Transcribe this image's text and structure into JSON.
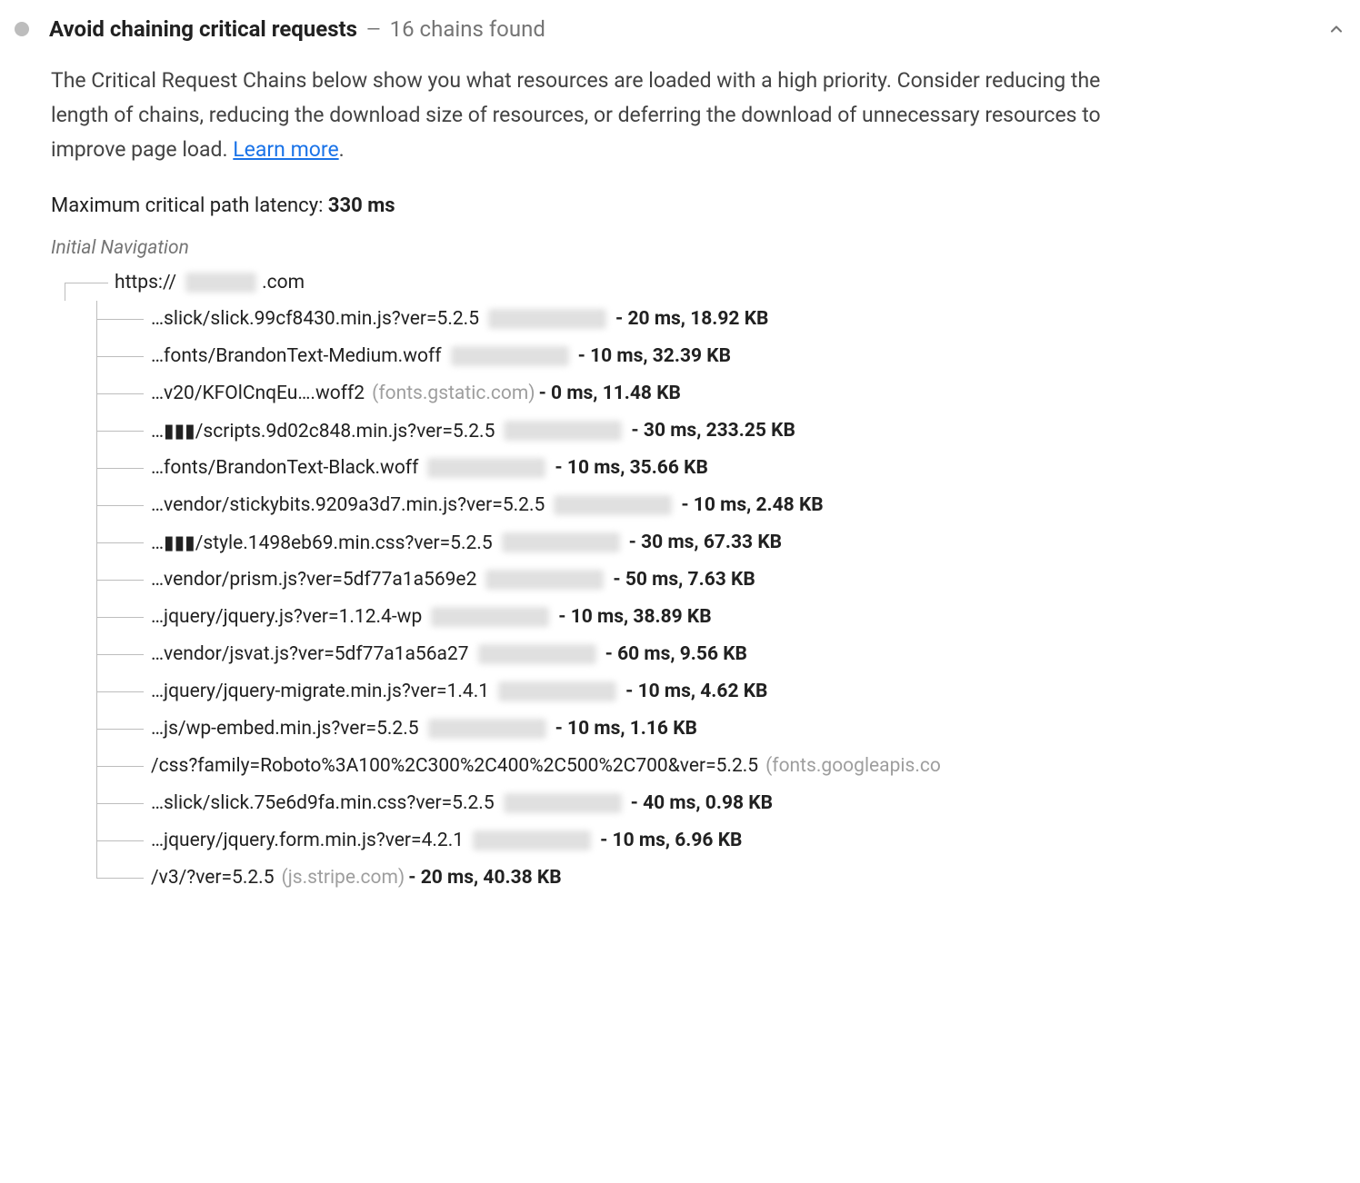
{
  "audit": {
    "title": "Avoid chaining critical requests",
    "count_text": "16 chains found",
    "description_pre": "The Critical Request Chains below show you what resources are loaded with a high priority. Consider reducing the length of chains, reducing the download size of resources, or deferring the download of unnecessary resources to improve page load. ",
    "learn_more": "Learn more",
    "latency_label": "Maximum critical path latency: ",
    "latency_value": "330 ms",
    "initial_navigation_label": "Initial Navigation",
    "root_url_prefix": "https://",
    "root_url_suffix": ".com",
    "rows": [
      {
        "url": "…slick/slick.99cf8430.min.js?ver=5.2.5",
        "origin": "",
        "origin_blur": true,
        "time": "20 ms",
        "size": "18.92 KB"
      },
      {
        "url": "…fonts/BrandonText-Medium.woff",
        "origin": "",
        "origin_blur": true,
        "time": "10 ms",
        "size": "32.39 KB"
      },
      {
        "url": "…v20/KFOlCnqEu….woff2",
        "origin": "(fonts.gstatic.com)",
        "origin_blur": false,
        "time": "0 ms",
        "size": "11.48 KB"
      },
      {
        "url": "…▮▮▮/scripts.9d02c848.min.js?ver=5.2.5",
        "origin": "",
        "origin_blur": true,
        "time": "30 ms",
        "size": "233.25 KB"
      },
      {
        "url": "…fonts/BrandonText-Black.woff",
        "origin": "",
        "origin_blur": true,
        "time": "10 ms",
        "size": "35.66 KB"
      },
      {
        "url": "…vendor/stickybits.9209a3d7.min.js?ver=5.2.5",
        "origin": "",
        "origin_blur": true,
        "time": "10 ms",
        "size": "2.48 KB"
      },
      {
        "url": "…▮▮▮/style.1498eb69.min.css?ver=5.2.5",
        "origin": "",
        "origin_blur": true,
        "time": "30 ms",
        "size": "67.33 KB"
      },
      {
        "url": "…vendor/prism.js?ver=5df77a1a569e2",
        "origin": "",
        "origin_blur": true,
        "time": "50 ms",
        "size": "7.63 KB"
      },
      {
        "url": "…jquery/jquery.js?ver=1.12.4-wp",
        "origin": "",
        "origin_blur": true,
        "time": "10 ms",
        "size": "38.89 KB"
      },
      {
        "url": "…vendor/jsvat.js?ver=5df77a1a56a27",
        "origin": "",
        "origin_blur": true,
        "time": "60 ms",
        "size": "9.56 KB"
      },
      {
        "url": "…jquery/jquery-migrate.min.js?ver=1.4.1",
        "origin": "",
        "origin_blur": true,
        "time": "10 ms",
        "size": "4.62 KB"
      },
      {
        "url": "…js/wp-embed.min.js?ver=5.2.5",
        "origin": "",
        "origin_blur": true,
        "time": "10 ms",
        "size": "1.16 KB"
      },
      {
        "url": "/css?family=Roboto%3A100%2C300%2C400%2C500%2C700&ver=5.2.5",
        "origin": "(fonts.googleapis.co",
        "origin_blur": false,
        "time": "",
        "size": ""
      },
      {
        "url": "…slick/slick.75e6d9fa.min.css?ver=5.2.5",
        "origin": "",
        "origin_blur": true,
        "time": "40 ms",
        "size": "0.98 KB"
      },
      {
        "url": "…jquery/jquery.form.min.js?ver=4.2.1",
        "origin": "",
        "origin_blur": true,
        "time": "10 ms",
        "size": "6.96 KB"
      },
      {
        "url": "/v3/?ver=5.2.5",
        "origin": "(js.stripe.com)",
        "origin_blur": false,
        "time": "20 ms",
        "size": "40.38 KB"
      }
    ]
  }
}
